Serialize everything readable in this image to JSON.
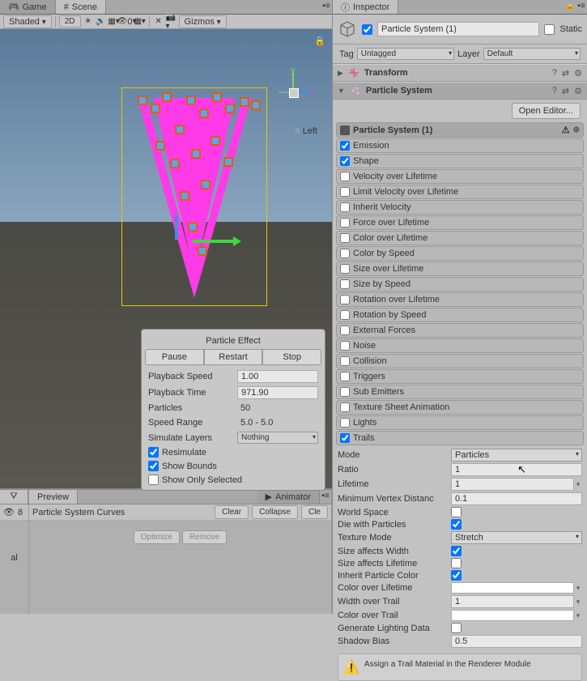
{
  "tabs": {
    "game": "Game",
    "scene": "Scene"
  },
  "toolbar": {
    "shading": "Shaded",
    "mode2d": "2D",
    "gizmos": "Gizmos",
    "visibility_num": "0"
  },
  "gizmo": {
    "x": "x",
    "y": "y",
    "z": "z",
    "perspective": "Left"
  },
  "particleEffect": {
    "title": "Particle Effect",
    "pause": "Pause",
    "restart": "Restart",
    "stop": "Stop",
    "playbackSpeed_label": "Playback Speed",
    "playbackSpeed": "1.00",
    "playbackTime_label": "Playback Time",
    "playbackTime": "971.90",
    "particles_label": "Particles",
    "particles": "50",
    "speedRange_label": "Speed Range",
    "speedRange": "5.0 - 5.0",
    "simulateLayers_label": "Simulate Layers",
    "simulateLayers": "Nothing",
    "resimulate": "Resimulate",
    "showBounds": "Show Bounds",
    "showOnlySelected": "Show Only Selected"
  },
  "bottomLeft": {
    "count": "8"
  },
  "preview": {
    "tab": "Preview",
    "animator": "Animator",
    "curves_label": "Particle System Curves",
    "optimize": "Optimize",
    "remove": "Remove",
    "clear": "Clear",
    "collapse": "Collapse",
    "cle": "Cle"
  },
  "inspector": {
    "tab": "Inspector",
    "name": "Particle System (1)",
    "static": "Static",
    "tag_label": "Tag",
    "tag": "Untagged",
    "layer_label": "Layer",
    "layer": "Default",
    "transform": "Transform",
    "particleSystem": "Particle System",
    "openEditor": "Open Editor...",
    "mainModule": "Particle System (1)",
    "modules": [
      {
        "label": "Emission",
        "checked": true
      },
      {
        "label": "Shape",
        "checked": true
      },
      {
        "label": "Velocity over Lifetime",
        "checked": false
      },
      {
        "label": "Limit Velocity over Lifetime",
        "checked": false
      },
      {
        "label": "Inherit Velocity",
        "checked": false
      },
      {
        "label": "Force over Lifetime",
        "checked": false
      },
      {
        "label": "Color over Lifetime",
        "checked": false
      },
      {
        "label": "Color by Speed",
        "checked": false
      },
      {
        "label": "Size over Lifetime",
        "checked": false
      },
      {
        "label": "Size by Speed",
        "checked": false
      },
      {
        "label": "Rotation over Lifetime",
        "checked": false
      },
      {
        "label": "Rotation by Speed",
        "checked": false
      },
      {
        "label": "External Forces",
        "checked": false
      },
      {
        "label": "Noise",
        "checked": false
      },
      {
        "label": "Collision",
        "checked": false
      },
      {
        "label": "Triggers",
        "checked": false
      },
      {
        "label": "Sub Emitters",
        "checked": false
      },
      {
        "label": "Texture Sheet Animation",
        "checked": false
      },
      {
        "label": "Lights",
        "checked": false
      },
      {
        "label": "Trails",
        "checked": true
      }
    ],
    "trails": {
      "mode_label": "Mode",
      "mode": "Particles",
      "ratio_label": "Ratio",
      "ratio": "1",
      "lifetime_label": "Lifetime",
      "lifetime": "1",
      "minVertex_label": "Minimum Vertex Distanc",
      "minVertex": "0.1",
      "worldSpace_label": "World Space",
      "dieWithParticles_label": "Die with Particles",
      "textureMode_label": "Texture Mode",
      "textureMode": "Stretch",
      "sizeAffectsWidth_label": "Size affects Width",
      "sizeAffectsLifetime_label": "Size affects Lifetime",
      "inheritColor_label": "Inherit Particle Color",
      "colorOverLifetime_label": "Color over Lifetime",
      "widthOverTrail_label": "Width over Trail",
      "widthOverTrail": "1",
      "colorOverTrail_label": "Color over Trail",
      "generateLighting_label": "Generate Lighting Data",
      "shadowBias_label": "Shadow Bias",
      "shadowBias": "0.5"
    },
    "warning": "Assign a Trail Material in the Renderer Module"
  }
}
